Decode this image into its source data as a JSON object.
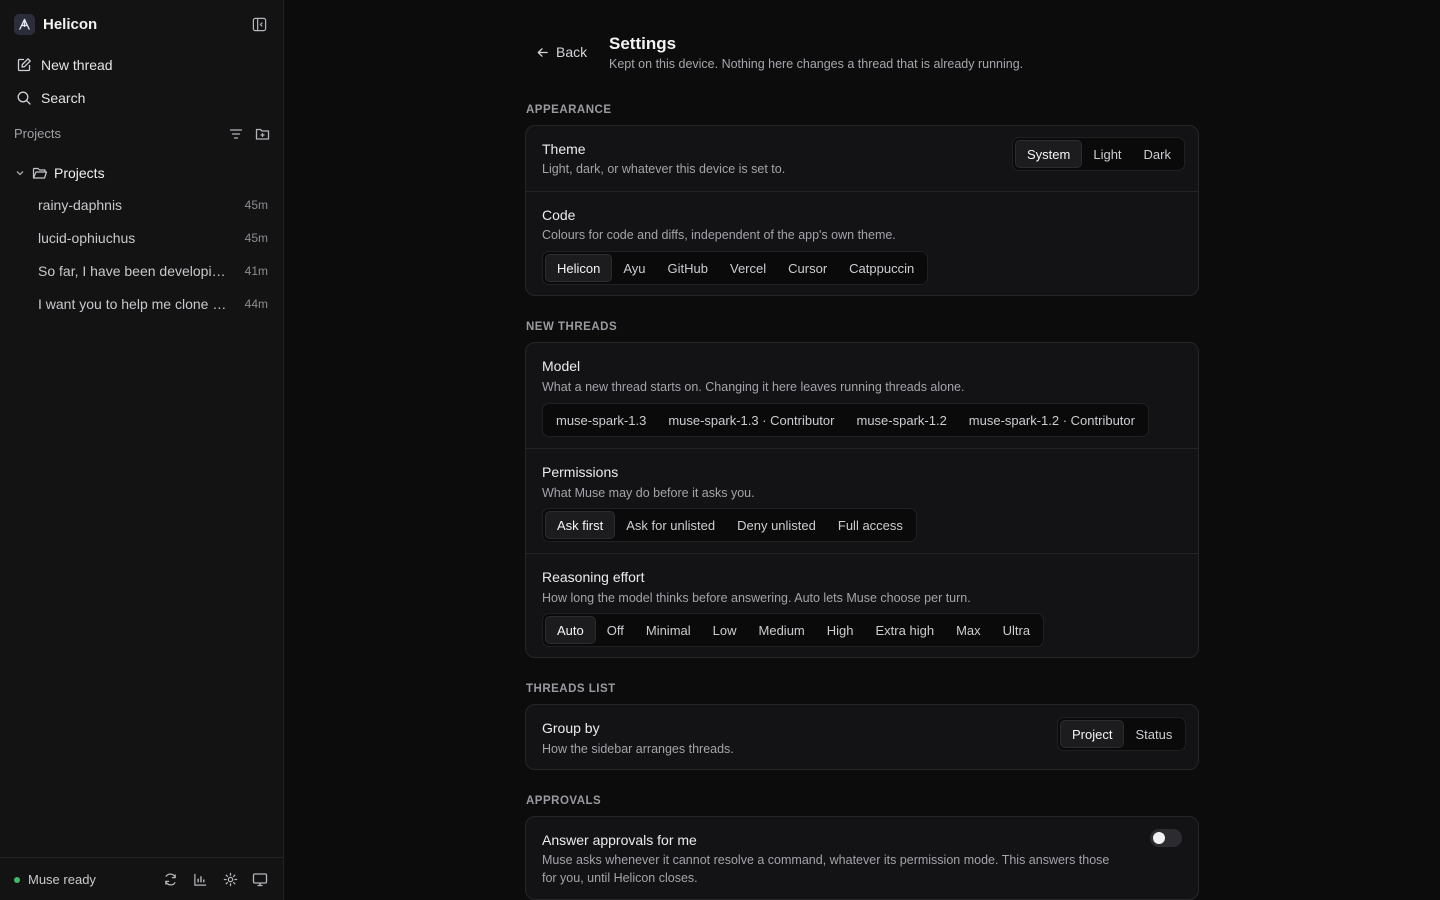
{
  "sidebar": {
    "app_name": "Helicon",
    "new_thread": "New thread",
    "search": "Search",
    "projects_label": "Projects",
    "group_name": "Projects",
    "threads": [
      {
        "title": "rainy-daphnis",
        "time": "45m"
      },
      {
        "title": "lucid-ophiuchus",
        "time": "45m"
      },
      {
        "title": "So far, I have been developin...",
        "time": "41m"
      },
      {
        "title": "I want you to help me clone al...",
        "time": "44m"
      }
    ],
    "status": "Muse ready"
  },
  "header": {
    "back": "Back",
    "title": "Settings",
    "subtitle": "Kept on this device. Nothing here changes a thread that is already running."
  },
  "appearance": {
    "heading": "APPEARANCE",
    "theme": {
      "title": "Theme",
      "desc": "Light, dark, or whatever this device is set to.",
      "options": [
        "System",
        "Light",
        "Dark"
      ],
      "selected": "System"
    },
    "code": {
      "title": "Code",
      "desc": "Colours for code and diffs, independent of the app's own theme.",
      "options": [
        "Helicon",
        "Ayu",
        "GitHub",
        "Vercel",
        "Cursor",
        "Catppuccin"
      ],
      "selected": "Helicon"
    }
  },
  "new_threads": {
    "heading": "NEW THREADS",
    "model": {
      "title": "Model",
      "desc": "What a new thread starts on. Changing it here leaves running threads alone.",
      "options": [
        "muse-spark-1.3",
        "muse-spark-1.3 · Contributor",
        "muse-spark-1.2",
        "muse-spark-1.2 · Contributor"
      ]
    },
    "permissions": {
      "title": "Permissions",
      "desc": "What Muse may do before it asks you.",
      "options": [
        "Ask first",
        "Ask for unlisted",
        "Deny unlisted",
        "Full access"
      ],
      "selected": "Ask first"
    },
    "reasoning": {
      "title": "Reasoning effort",
      "desc": "How long the model thinks before answering. Auto lets Muse choose per turn.",
      "options": [
        "Auto",
        "Off",
        "Minimal",
        "Low",
        "Medium",
        "High",
        "Extra high",
        "Max",
        "Ultra"
      ],
      "selected": "Auto"
    }
  },
  "threads_list": {
    "heading": "THREADS LIST",
    "group_by": {
      "title": "Group by",
      "desc": "How the sidebar arranges threads.",
      "options": [
        "Project",
        "Status"
      ],
      "selected": "Project"
    }
  },
  "approvals": {
    "heading": "APPROVALS",
    "auto": {
      "title": "Answer approvals for me",
      "desc_line1": "Muse asks whenever it cannot resolve a command, whatever its permission mode. This answers those",
      "desc_line2": "for you, until Helicon closes.",
      "enabled": false
    }
  },
  "colors": {
    "accent_status": "#3fb96b",
    "background": "#0c0c0d",
    "sidebar": "#131314",
    "card": "#131315"
  }
}
